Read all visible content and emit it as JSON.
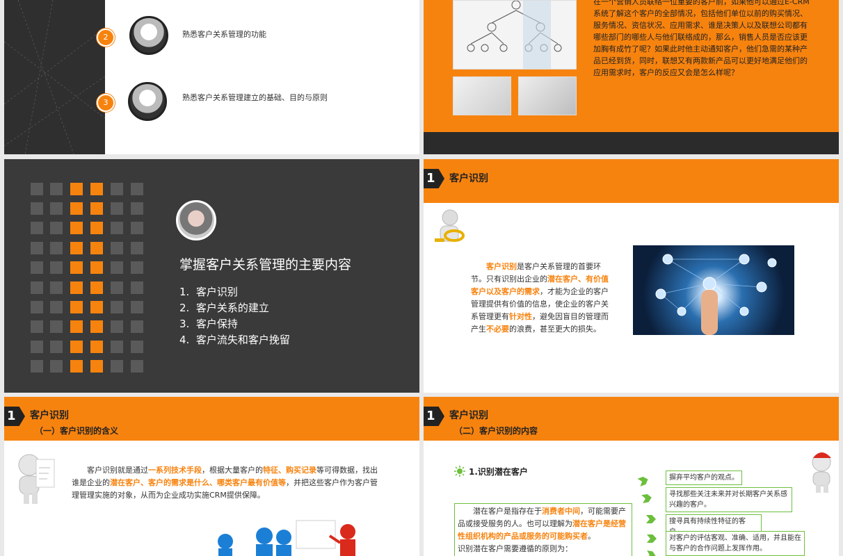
{
  "slide1": {
    "items": [
      {
        "num": "2",
        "text": "熟悉客户关系管理的功能"
      },
      {
        "num": "3",
        "text": "熟悉客户关系管理建立的基础、目的与原则"
      }
    ]
  },
  "slide2": {
    "paragraph": "在一个营销人员联络一位重要的客户前，如果他可以通过E-CRM系统了解这个客户的全部情况，包括他们单位以前的购买情况、服务情况、资信状况、应用需求、谁是决策人以及联想公司都有哪些部门的哪些人与他们联络成的，那么，销售人员是否应该更加胸有成竹了呢？如果此时他主动通知客户，他们急需的某种产品已经到货，同时，联想又有两款新产品可以更好地满足他们的应用需求时，客户的反应又会是怎么样呢？"
  },
  "slide3": {
    "title": "掌握客户关系管理的主要内容",
    "list": [
      {
        "n": "1.",
        "t": "客户识别"
      },
      {
        "n": "2.",
        "t": "客户关系的建立"
      },
      {
        "n": "3.",
        "t": "客户保持"
      },
      {
        "n": "4.",
        "t": "客户流失和客户挽留"
      }
    ]
  },
  "slide4": {
    "badge": "1",
    "title": "客户识别",
    "p": {
      "a": "客户识别",
      "b": "是客户关系管理的首要环节。只有识别出企业的",
      "c": "潜在客户、有价值客户以及客户的需求",
      "d": "，才能为企业的客户管理提供有价值的信息，使企业的客户关系管理更有",
      "e": "针对性",
      "f": "，避免因盲目的管理而产生",
      "g": "不必要",
      "h": "的浪费，甚至更大的损失。"
    }
  },
  "slide5": {
    "badge": "1",
    "title": "客户识别",
    "subtitle": "（一）客户识别的含义",
    "p": {
      "a": "客户识别就是通过",
      "b": "一系列技术手段",
      "c": "，根据大量客户的",
      "d": "特征、购买记录",
      "e": "等可得数据，找出谁是企业的",
      "f": "潜在客户、客户的需求是什么、哪类客户最有价值等",
      "g": "，并把这些客户作为客户管理管理实施的对象，从而为企业成功实施CRM提供保障。"
    }
  },
  "slide6": {
    "badge": "1",
    "title": "客户识别",
    "subtitle": "（二）客户识别的内容",
    "heading": "1.识别潜在客户",
    "box": {
      "a": "潜在客户是指存在于",
      "b": "消费者中间",
      "c": "，可能需要产品或接受服务的人。也可以理解为",
      "d": "潜在客户是经营性组织机构的产品或服务的可能购买者",
      "e": "。",
      "f": "识别潜在客户需要遵循的原则为："
    },
    "callouts": [
      "摒弃平均客户的观点。",
      "寻找那些关注未来并对长期客户关系感兴趣的客户。",
      "搜寻具有持续性特征的客户。",
      "对客户的评估客观、准确、适用，并且能在与客户的合作问题上发挥作用。"
    ]
  },
  "colors": {
    "accent": "#f7830f",
    "dark": "#3a3a3a",
    "green": "#6cbf3c"
  }
}
